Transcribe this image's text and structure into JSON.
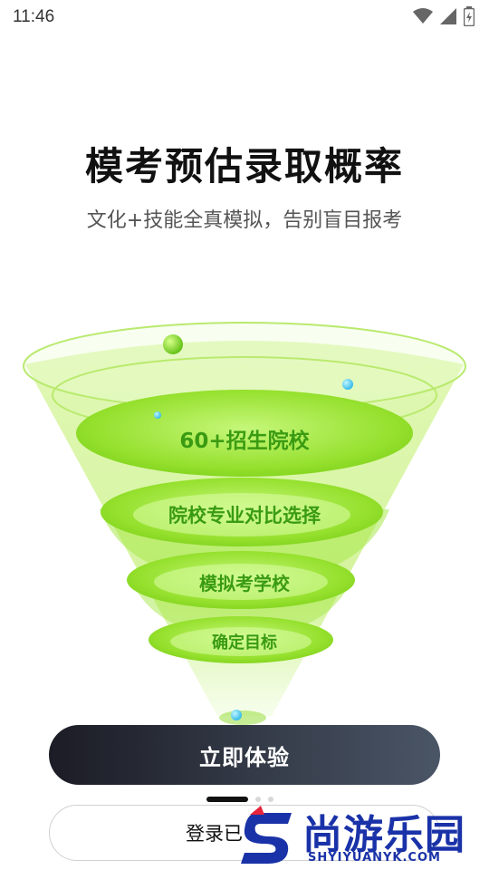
{
  "status": {
    "time": "11:46",
    "icons": [
      "wifi-icon",
      "signal-icon",
      "battery-charging-icon"
    ]
  },
  "hero": {
    "title": "模考预估录取概率",
    "subtitle": "文化+技能全真模拟，告别盲目报考"
  },
  "funnel": {
    "tiers": [
      "60+招生院校",
      "院校专业对比选择",
      "模拟考学校",
      "确定目标"
    ],
    "colors": {
      "rim": "#c8f08a",
      "body": "#9be23a",
      "label": "#3a9b12"
    }
  },
  "actions": {
    "primary_label": "立即体验",
    "secondary_label": "登录已"
  },
  "pager": {
    "count": 3,
    "active": 0
  },
  "watermark": {
    "brand": "尚游乐园",
    "url": "SHYIYUANYK.COM"
  }
}
